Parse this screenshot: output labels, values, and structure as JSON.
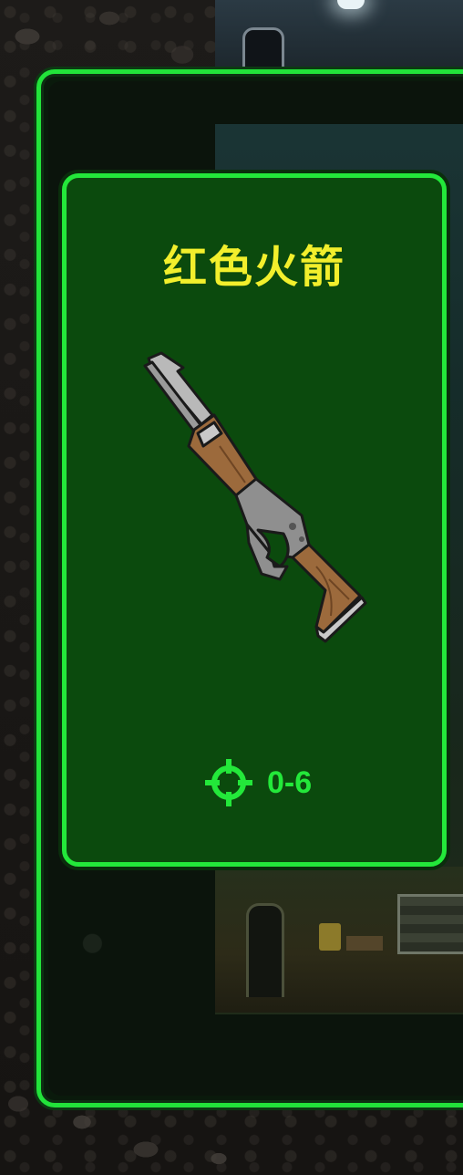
{
  "item": {
    "name": "红色火箭",
    "weapon_icon": "lever-action-rifle-icon",
    "damage_icon": "crosshair-icon",
    "damage_range": "0-6"
  },
  "colors": {
    "frame_green": "#23e83a",
    "card_bg": "#0b4a0d",
    "title_yellow": "#f2ef2c"
  }
}
